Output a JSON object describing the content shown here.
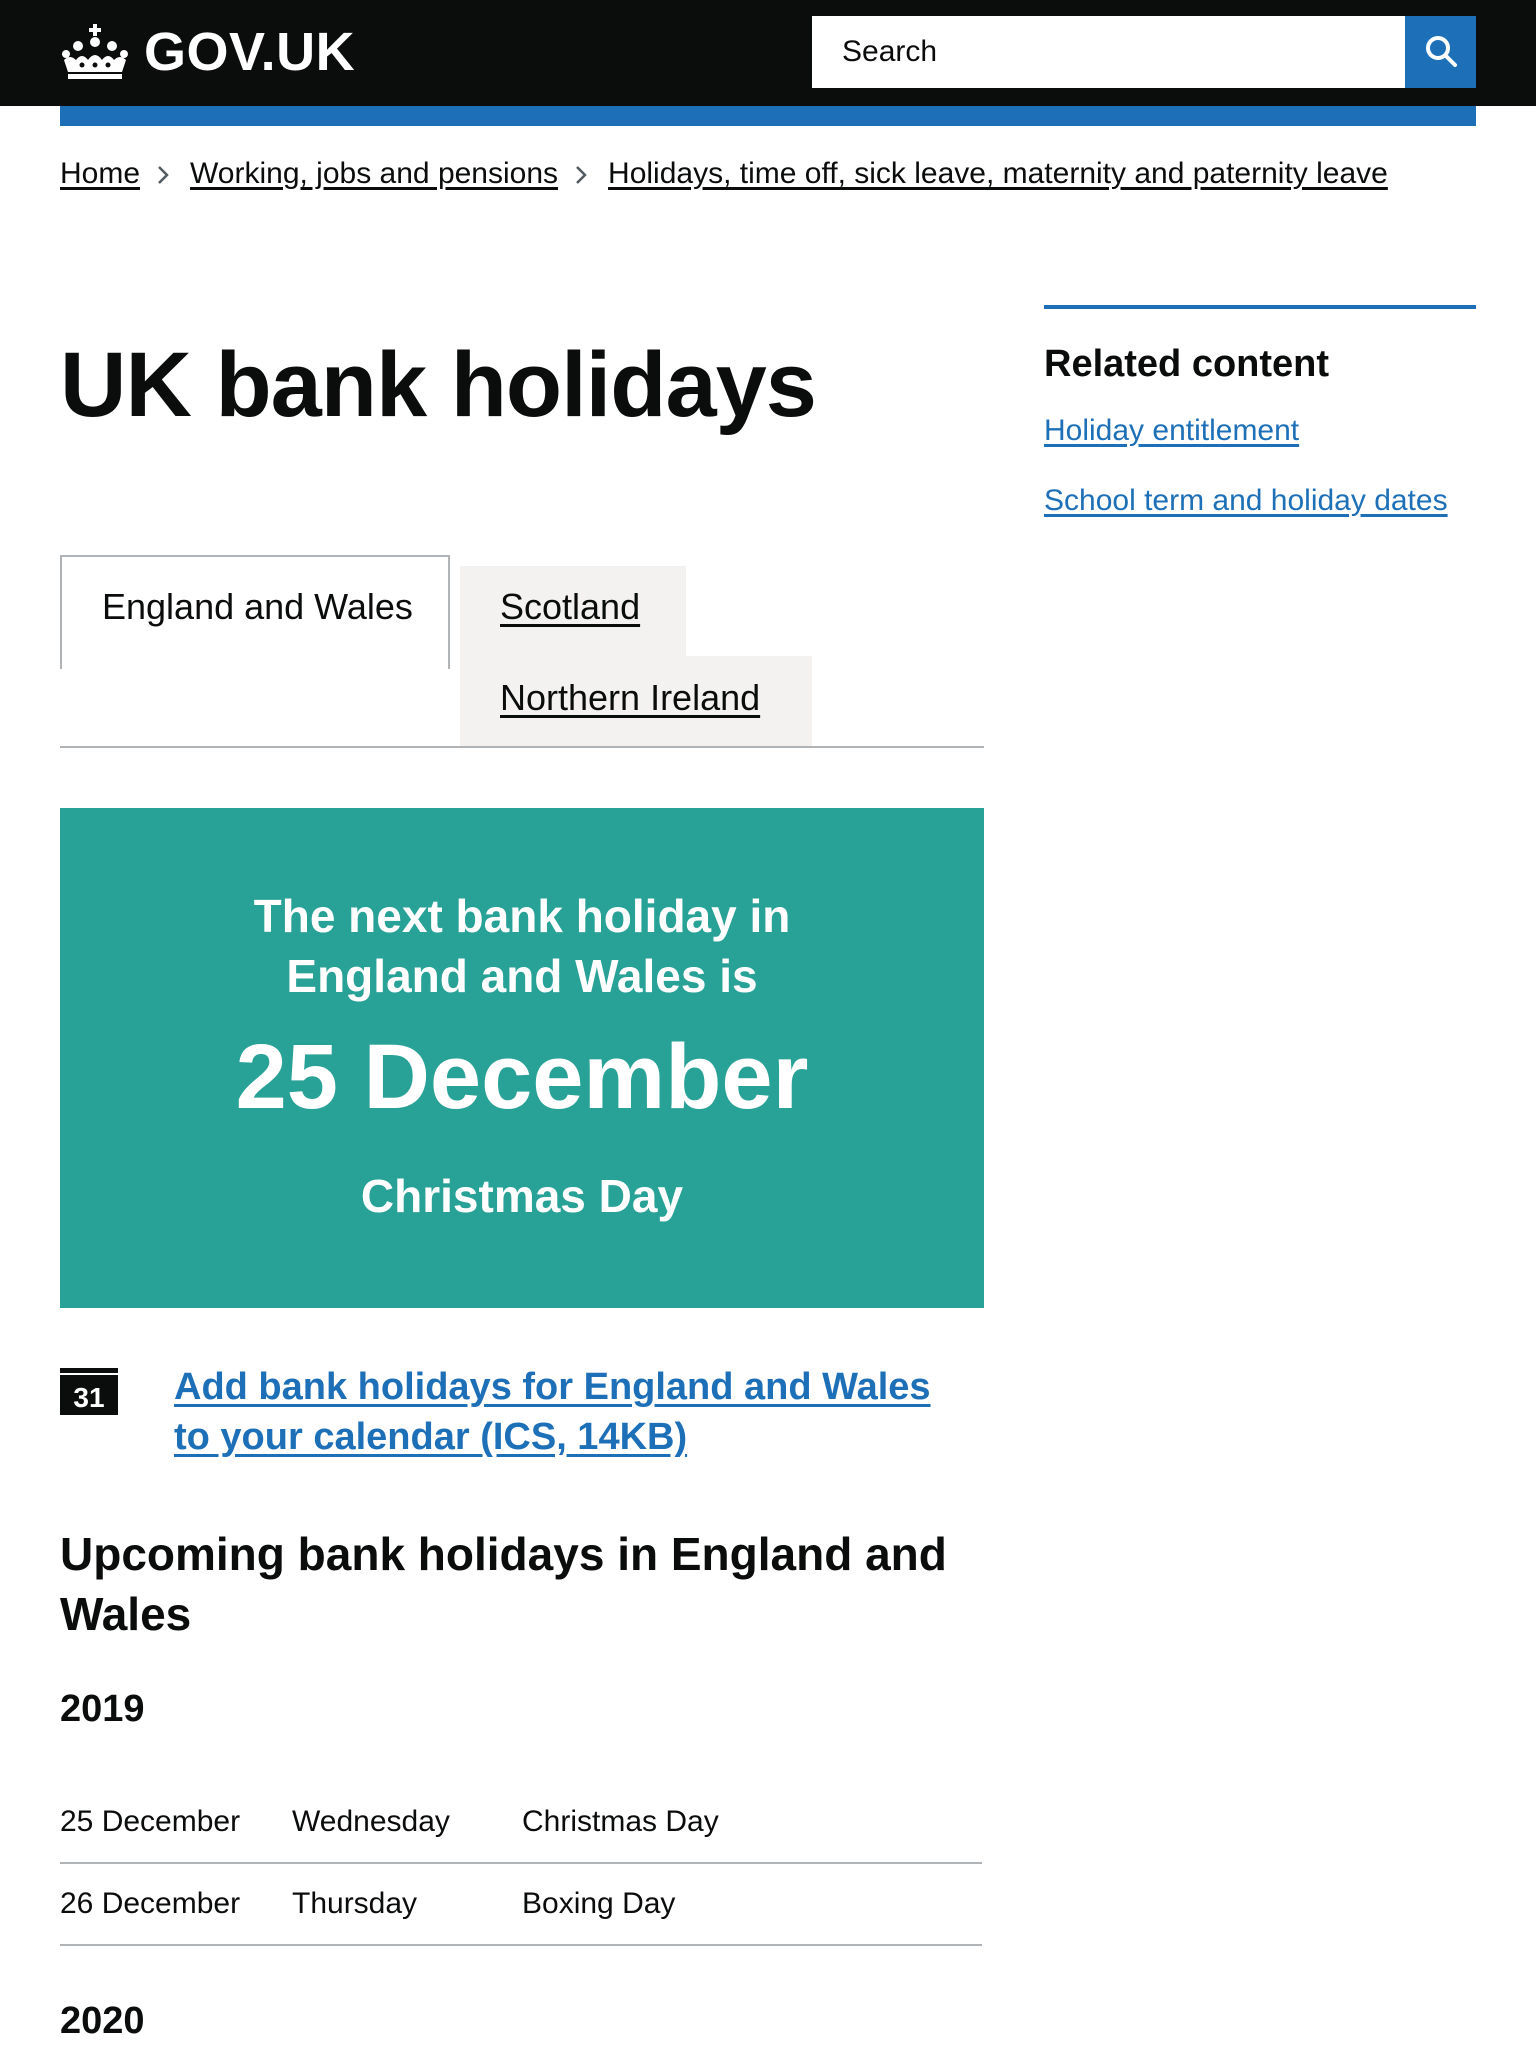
{
  "header": {
    "logo_text": "GOV.UK",
    "search_placeholder": "Search"
  },
  "breadcrumb": [
    {
      "label": "Home"
    },
    {
      "label": "Working, jobs and pensions"
    },
    {
      "label": "Holidays, time off, sick leave, maternity and paternity leave"
    }
  ],
  "title": "UK bank holidays",
  "tabs": {
    "active": "England and Wales",
    "scotland": "Scotland",
    "northern_ireland": "Northern Ireland"
  },
  "panel": {
    "intro": "The next bank holiday in England and Wales is",
    "date": "25 December",
    "name": "Christmas Day"
  },
  "calendar": {
    "icon_number": "31",
    "link_text": "Add bank holidays for England and Wales to your calendar (ICS, 14KB)"
  },
  "upcoming": {
    "heading": "Upcoming bank holidays in England and Wales",
    "years": [
      {
        "year": "2019",
        "rows": [
          {
            "date": "25 December",
            "day": "Wednesday",
            "name": "Christmas Day"
          },
          {
            "date": "26 December",
            "day": "Thursday",
            "name": "Boxing Day"
          }
        ]
      },
      {
        "year": "2020",
        "rows": []
      }
    ]
  },
  "sidebar": {
    "heading": "Related content",
    "links": [
      {
        "label": "Holiday entitlement"
      },
      {
        "label": "School term and holiday dates"
      }
    ]
  },
  "colors": {
    "header_bg": "#0b0c0c",
    "brand_blue": "#1d70b8",
    "panel_turquoise": "#28a197",
    "tab_inactive_bg": "#f3f2f1",
    "border_grey": "#b1b4b6"
  }
}
